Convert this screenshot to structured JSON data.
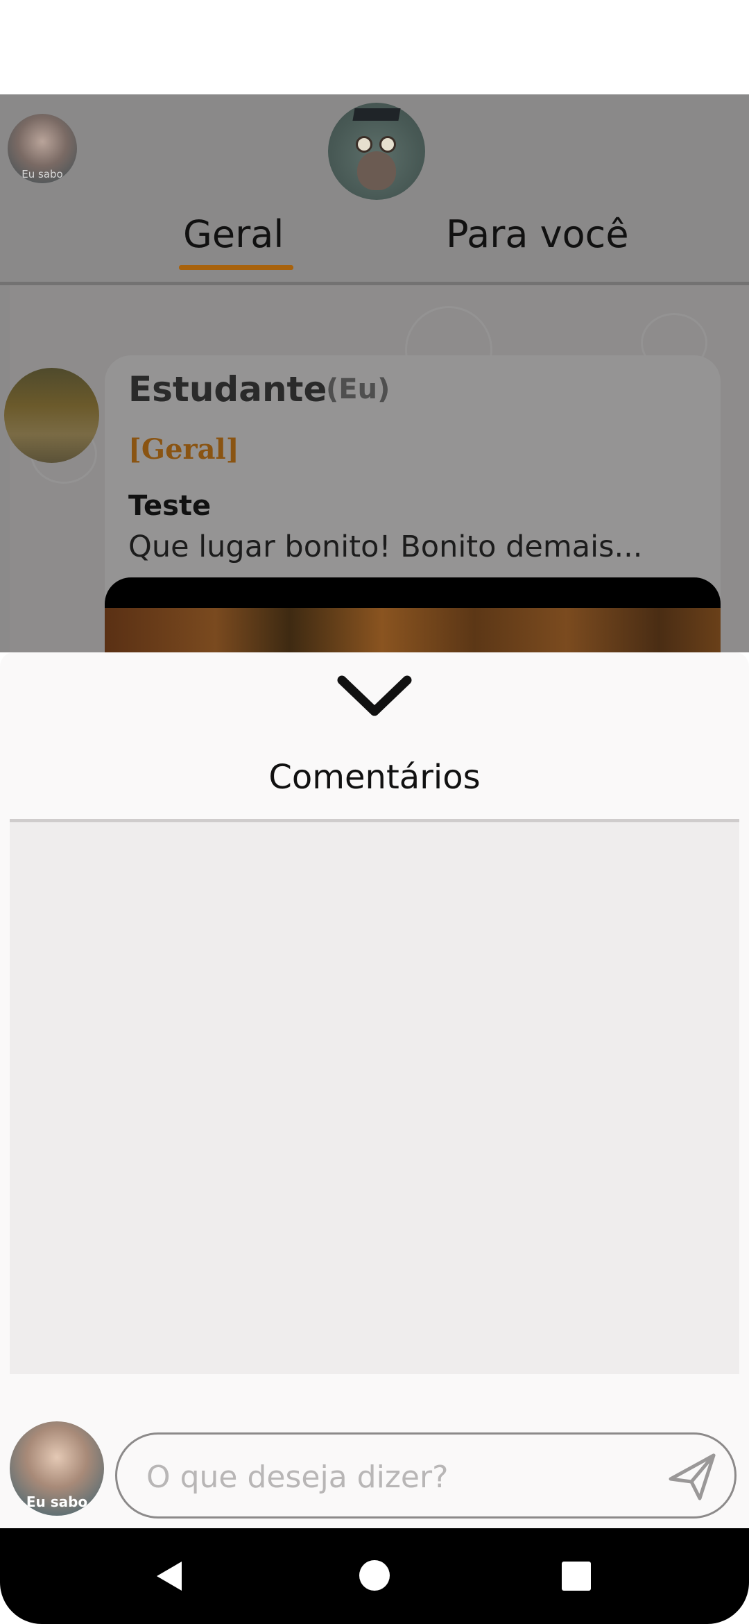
{
  "header": {
    "avatar_caption": "Eu sabo",
    "tabs": [
      {
        "label": "Geral",
        "active": true
      },
      {
        "label": "Para você",
        "active": false
      }
    ]
  },
  "post": {
    "author": "Estudante",
    "author_tag": "(Eu)",
    "category": "[Geral]",
    "title": "Teste",
    "text": "Que lugar bonito! Bonito demais..."
  },
  "comments_sheet": {
    "title": "Comentários",
    "composer_avatar_caption": "Eu sabo",
    "input_placeholder": "O que deseja dizer?",
    "input_value": ""
  },
  "colors": {
    "accent": "#a8620c",
    "category_text": "#8a5412",
    "sheet_background": "#faf9f9",
    "comments_background": "#efeded"
  },
  "icons": [
    "chevron-down-icon",
    "send-icon",
    "nav-back-icon",
    "nav-home-icon",
    "nav-recent-icon"
  ]
}
